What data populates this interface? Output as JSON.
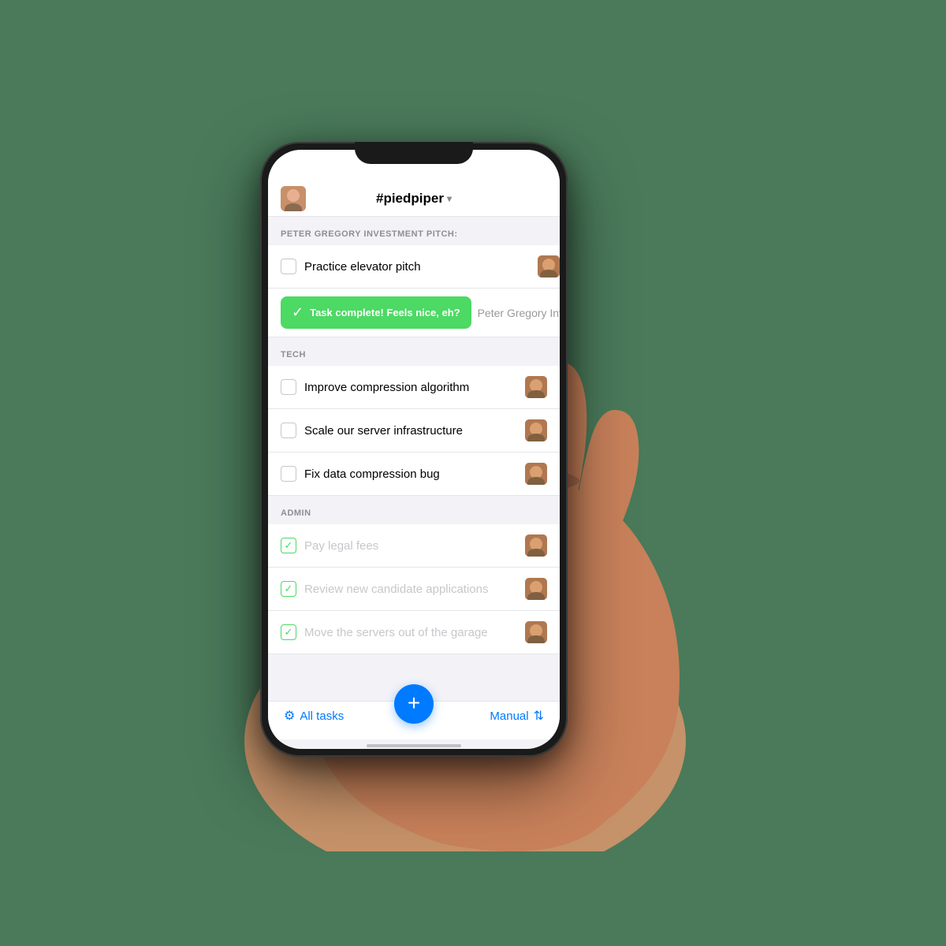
{
  "background": {
    "color": "#4a7a5a"
  },
  "phone": {
    "header": {
      "channel": "#piedpiper",
      "chevron": "▾"
    },
    "toast": {
      "message": "Task complete! Feels nice, eh?",
      "assignee_preview": "Peter Gregory Inv"
    },
    "sections": [
      {
        "id": "peter-gregory",
        "title": "PETER GREGORY INVESTMENT PITCH:",
        "tasks": [
          {
            "id": "task-1",
            "text": "Practice elevator pitch",
            "completed": false,
            "has_toast": true
          }
        ]
      },
      {
        "id": "tech",
        "title": "TECH",
        "tasks": [
          {
            "id": "task-2",
            "text": "Improve compression algorithm",
            "completed": false
          },
          {
            "id": "task-3",
            "text": "Scale our server infrastructure",
            "completed": false
          },
          {
            "id": "task-4",
            "text": "Fix data compression bug",
            "completed": false
          }
        ]
      },
      {
        "id": "admin",
        "title": "ADMIN",
        "tasks": [
          {
            "id": "task-5",
            "text": "Pay legal fees",
            "completed": true
          },
          {
            "id": "task-6",
            "text": "Review new candidate applications",
            "completed": true
          },
          {
            "id": "task-7",
            "text": "Move the servers out of the garage",
            "completed": true
          }
        ]
      }
    ],
    "bottom_bar": {
      "all_tasks_label": "All tasks",
      "manual_label": "Manual"
    }
  }
}
